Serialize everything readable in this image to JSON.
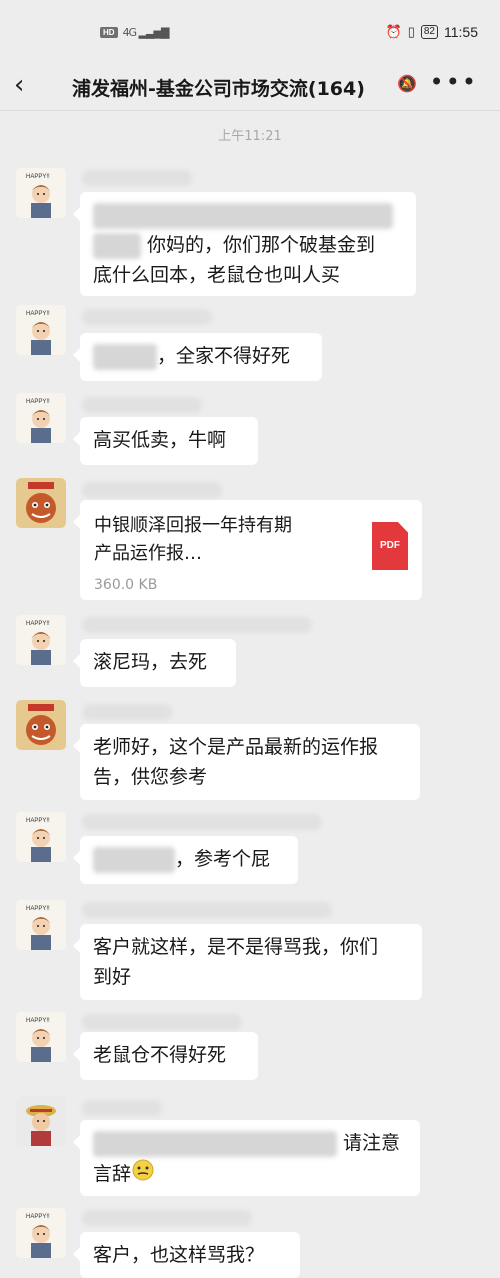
{
  "status_bar": {
    "network_badge": "HD",
    "network_type": "4G",
    "battery": "82",
    "time": "11:55"
  },
  "header": {
    "back_icon": "chevron-left-icon",
    "title": "浦发福州-基金公司市场交流(164)",
    "mute_icon": "bell-muted-icon",
    "more_icon": "more-dots-icon"
  },
  "timestamp": "上午11:21",
  "messages": [
    {
      "avatar": "happy-boy-avatar",
      "line1": "你妈的，你们那个破基金到",
      "line2": "底什么回本，老鼠仓也叫人买"
    },
    {
      "avatar": "happy-boy-avatar",
      "text": "，全家不得好死"
    },
    {
      "avatar": "happy-boy-avatar",
      "text": "高买低卖，牛啊"
    },
    {
      "avatar": "lion-dance-avatar",
      "file_name_line1": "中银顺泽回报一年持有期",
      "file_name_line2": "产品运作报…",
      "file_size": "360.0 KB",
      "file_badge": "PDF"
    },
    {
      "avatar": "happy-boy-avatar",
      "text": "滚尼玛，去死"
    },
    {
      "avatar": "lion-dance-avatar",
      "line1": "老师好，这个是产品最新的运作报",
      "line2": "告，供您参考"
    },
    {
      "avatar": "happy-boy-avatar",
      "text": "，参考个屁"
    },
    {
      "avatar": "happy-boy-avatar",
      "line1": "客户就这样，是不是得骂我，你们",
      "line2": "到好"
    },
    {
      "avatar": "happy-boy-avatar",
      "text": "老鼠仓不得好死"
    },
    {
      "avatar": "cartoon-pirate-avatar",
      "line1": "请注意",
      "line2": "言辞"
    },
    {
      "avatar": "happy-boy-avatar",
      "text": "客户，也这样骂我？"
    }
  ],
  "colors": {
    "background": "#ededed",
    "bubble": "#ffffff",
    "pdf": "#e4393c",
    "timestamp": "#a9a9a9"
  }
}
